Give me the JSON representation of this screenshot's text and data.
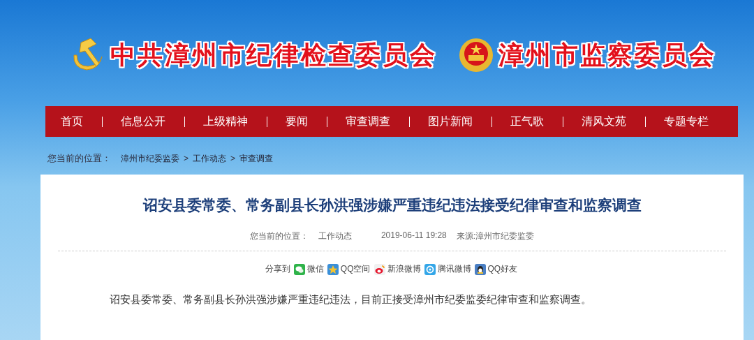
{
  "header": {
    "titles": [
      {
        "kind": "party",
        "text": "中共漳州市纪律检查委员会"
      },
      {
        "kind": "national",
        "text": "漳州市监察委员会"
      }
    ]
  },
  "nav": {
    "items": [
      "首页",
      "信息公开",
      "上级精神",
      "要闻",
      "审查调查",
      "图片新闻",
      "正气歌",
      "清风文苑",
      "专题专栏"
    ]
  },
  "breadcrumb": {
    "label": "您当前的位置：",
    "items": [
      {
        "kind": "link",
        "text": "漳州市纪委监委"
      },
      {
        "kind": "sep",
        "text": ">"
      },
      {
        "kind": "link",
        "text": "工作动态"
      },
      {
        "kind": "sep",
        "text": ">"
      },
      {
        "kind": "link",
        "text": "审查调查"
      }
    ]
  },
  "article": {
    "title": "诏安县委常委、常务副县长孙洪强涉嫌严重违纪违法接受纪律审查和监察调查",
    "meta": {
      "location_label": "您当前的位置：",
      "location": "工作动态",
      "date": "2019-06-11 19:28",
      "source": "来源:漳州市纪委监委"
    },
    "share": {
      "label": "分享到",
      "targets": [
        {
          "kind": "wechat",
          "text": "微信"
        },
        {
          "kind": "qzone",
          "text": "QQ空间"
        },
        {
          "kind": "weibo",
          "text": "新浪微博"
        },
        {
          "kind": "tweibo",
          "text": "腾讯微博"
        },
        {
          "kind": "qq",
          "text": "QQ好友"
        }
      ]
    },
    "body": "诏安县委常委、常务副县长孙洪强涉嫌严重违纪违法，目前正接受漳州市纪委监委纪律审查和监察调查。"
  }
}
